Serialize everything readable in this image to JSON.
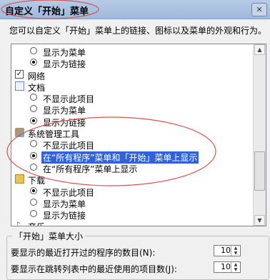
{
  "window": {
    "title": "自定义「开始」菜单",
    "close_symbol": "✕"
  },
  "description": "您可以自定义「开始」菜单上的链接、图标以及菜单的外观和行为。",
  "list": {
    "items": [
      {
        "kind": "radio",
        "indent": 2,
        "checked": false,
        "label": "显示为菜单"
      },
      {
        "kind": "radio",
        "indent": 2,
        "checked": true,
        "label": "显示为链接"
      },
      {
        "kind": "checkbox",
        "indent": 0,
        "checked": true,
        "label": "网络"
      },
      {
        "kind": "group",
        "indent": 0,
        "icon": "documents-icon",
        "label": "文档"
      },
      {
        "kind": "radio",
        "indent": 2,
        "checked": false,
        "label": "不显示此项目"
      },
      {
        "kind": "radio",
        "indent": 2,
        "checked": false,
        "label": "显示为菜单"
      },
      {
        "kind": "radio",
        "indent": 2,
        "checked": true,
        "label": "显示为链接"
      },
      {
        "kind": "group",
        "indent": 0,
        "icon": "admin-tools-icon",
        "label": "系统管理工具"
      },
      {
        "kind": "radio",
        "indent": 2,
        "checked": false,
        "label": "不显示此项目"
      },
      {
        "kind": "radio",
        "indent": 2,
        "checked": true,
        "label": "在“所有程序”菜单和「开始」菜单上显示",
        "selected": true
      },
      {
        "kind": "radio",
        "indent": 2,
        "checked": false,
        "label": "在“所有程序”菜单上显示"
      },
      {
        "kind": "group",
        "indent": 0,
        "icon": "downloads-icon",
        "label": "下载"
      },
      {
        "kind": "radio",
        "indent": 2,
        "checked": true,
        "label": "不显示此项目"
      },
      {
        "kind": "radio",
        "indent": 2,
        "checked": false,
        "label": "显示为菜单"
      },
      {
        "kind": "radio",
        "indent": 2,
        "checked": false,
        "label": "显示为链接"
      },
      {
        "kind": "group",
        "indent": 0,
        "icon": "music-icon",
        "label": "音乐"
      }
    ]
  },
  "menu_size": {
    "title": "「开始」菜单大小",
    "recent_programs_label": "要显示的最近打开过的程序的数目(N):",
    "recent_programs_value": "10",
    "jump_list_label": "要显示在跳转列表中的最近使用的项目数(J):",
    "jump_list_value": "10"
  },
  "colors": {
    "selection": "#3162d7",
    "annotation": "#d9534f"
  }
}
